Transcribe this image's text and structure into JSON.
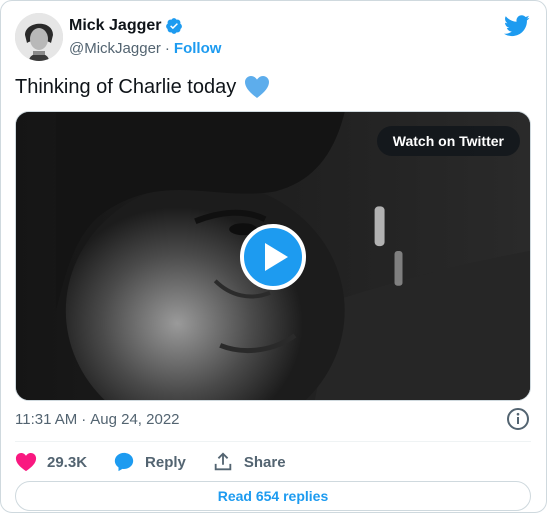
{
  "author": {
    "name": "Mick Jagger",
    "handle": "@MickJagger",
    "follow_label": "Follow"
  },
  "tweet": {
    "text": "Thinking of Charlie today",
    "emoji_icon": "blue-heart-icon",
    "time": "11:31 AM",
    "separator": "·",
    "date": "Aug 24, 2022"
  },
  "media": {
    "watch_label": "Watch on Twitter",
    "play_icon": "play-icon"
  },
  "actions": {
    "likes_count": "29.3K",
    "reply_label": "Reply",
    "share_label": "Share"
  },
  "replies": {
    "read_label": "Read 654 replies"
  },
  "colors": {
    "accent": "#1d9bf0",
    "like": "#f91880",
    "text": "#0f1419",
    "muted": "#536471"
  }
}
